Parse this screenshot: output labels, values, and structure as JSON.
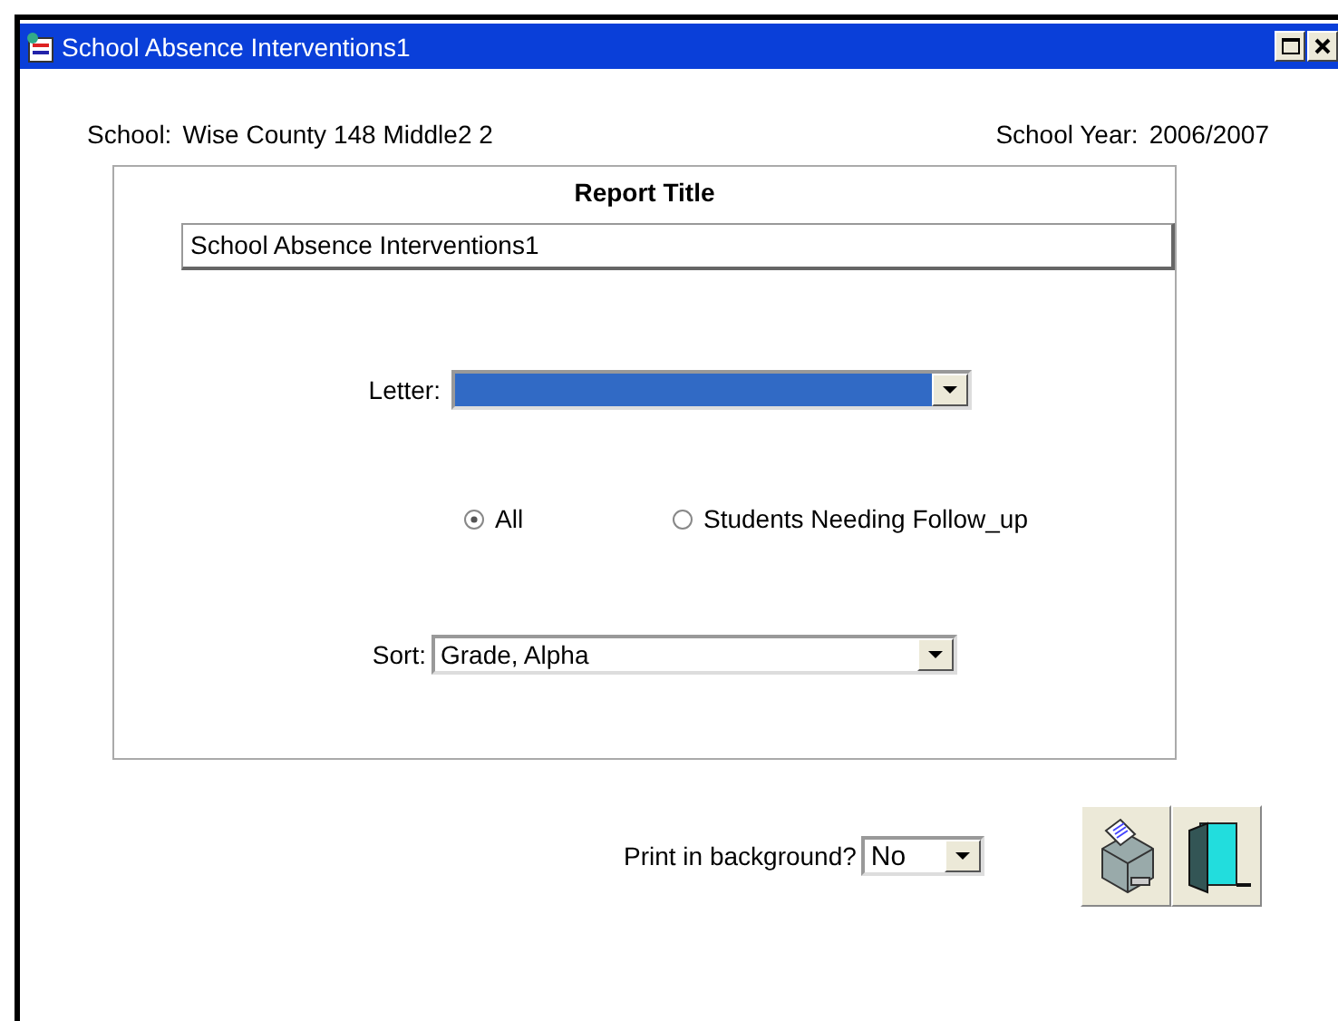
{
  "window": {
    "title": "School Absence Interventions1"
  },
  "header": {
    "school_label": "School:",
    "school": "Wise County 148 Middle2 2",
    "year_label": "School Year:",
    "year": "2006/2007"
  },
  "report_title": {
    "label": "Report Title",
    "value": "School Absence Interventions1"
  },
  "letter": {
    "label": "Letter:",
    "focused": true
  },
  "filter": [
    {
      "label": "All",
      "selected": true
    },
    {
      "label": "Students Needing Follow_up",
      "selected": false
    }
  ],
  "sort": {
    "label": "Sort:",
    "value": "Grade, Alpha"
  },
  "print_background": {
    "label": "Print in background?",
    "value": "No"
  }
}
